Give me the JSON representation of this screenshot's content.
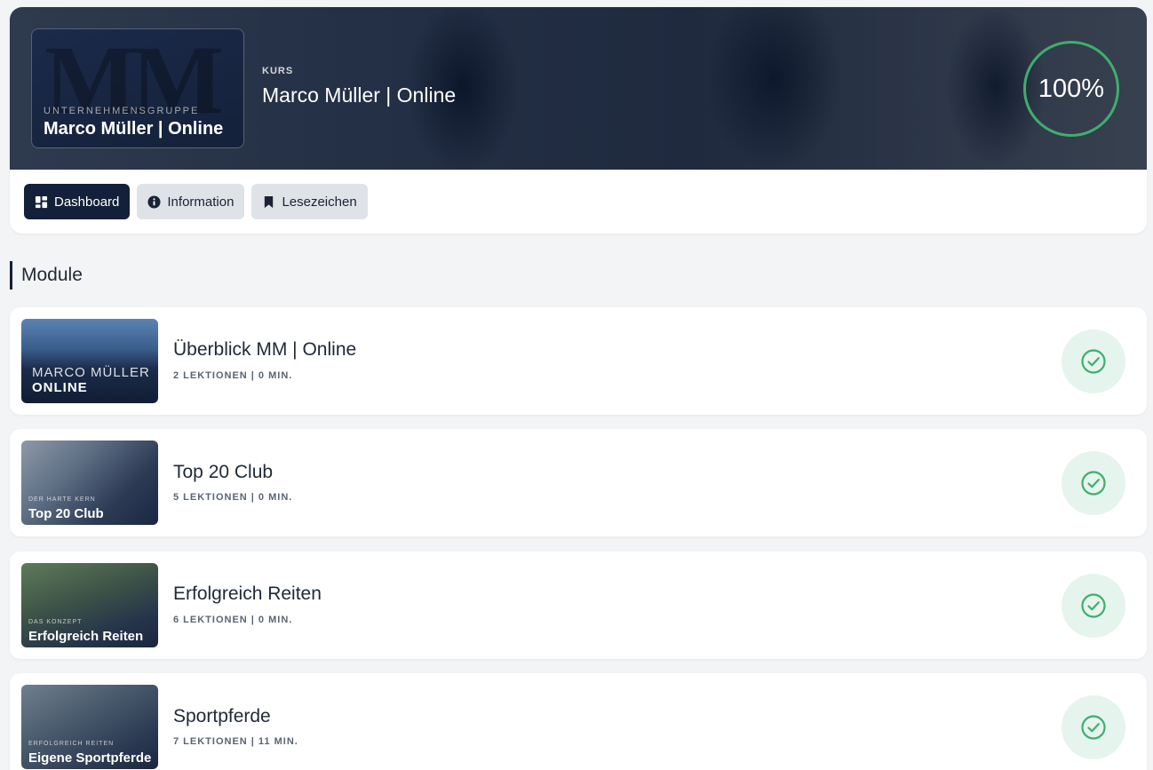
{
  "course": {
    "logo_subtitle": "UNTERNEHMENSGRUPPE",
    "logo_name": "Marco Müller | Online",
    "logo_monogram": "MM",
    "kicker": "KURS",
    "title": "Marco Müller | Online",
    "progress_percent": 100,
    "progress_label": "100%"
  },
  "tabs": [
    {
      "label": "Dashboard",
      "icon": "dashboard-icon",
      "active": true
    },
    {
      "label": "Information",
      "icon": "info-icon",
      "active": false
    },
    {
      "label": "Lesezeichen",
      "icon": "bookmark-icon",
      "active": false
    }
  ],
  "section": {
    "title": "Module"
  },
  "modules": [
    {
      "title": "Überblick MM | Online",
      "meta": "2 LEKTIONEN | 0 MIN.",
      "thumb_small": "MARCO MÜLLER",
      "thumb_big": "ONLINE",
      "status": "completed"
    },
    {
      "title": "Top 20 Club",
      "meta": "5 LEKTIONEN | 0 MIN.",
      "thumb_small": "DER HARTE KERN",
      "thumb_big": "Top 20 Club",
      "status": "completed"
    },
    {
      "title": "Erfolgreich Reiten",
      "meta": "6 LEKTIONEN | 0 MIN.",
      "thumb_small": "DAS KONZEPT",
      "thumb_big": "Erfolgreich Reiten",
      "status": "completed"
    },
    {
      "title": "Sportpferde",
      "meta": "7 LEKTIONEN | 11 MIN.",
      "thumb_small": "ERFOLGREICH REITEN",
      "thumb_big": "Eigene Sportpferde",
      "status": "completed"
    }
  ],
  "colors": {
    "primary": "#142039",
    "success": "#3fae6d",
    "success_bg": "#e5f4ec",
    "background": "#f3f4f6"
  }
}
